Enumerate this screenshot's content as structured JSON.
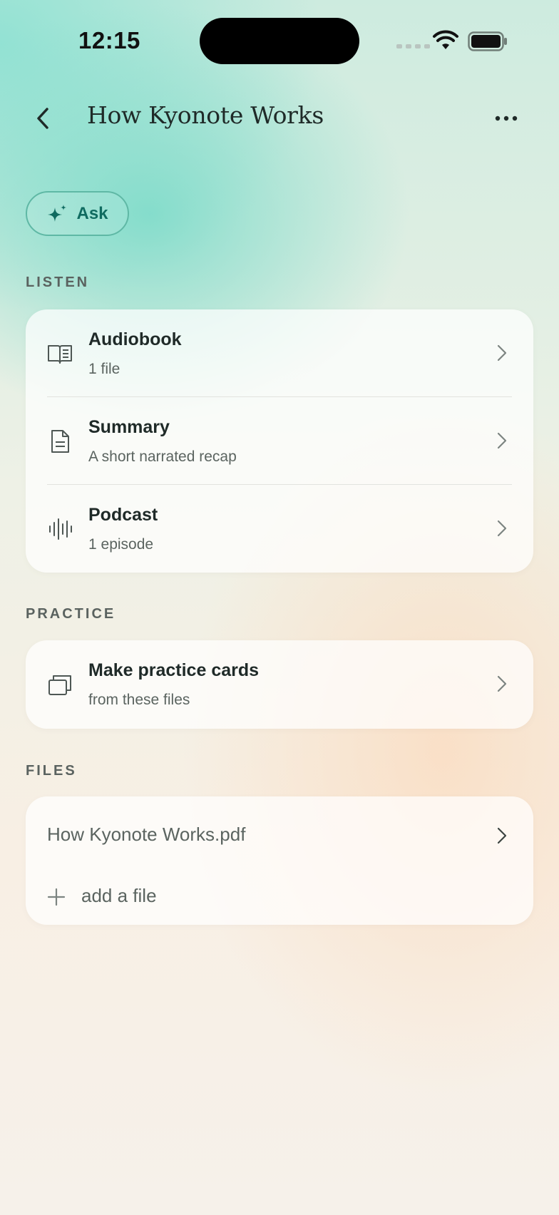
{
  "status_bar": {
    "time": "12:15"
  },
  "header": {
    "title": "How Kyonote Works"
  },
  "ask": {
    "label": "Ask"
  },
  "sections": {
    "listen": "LISTEN",
    "practice": "PRACTICE",
    "files": "FILES"
  },
  "listen_items": [
    {
      "title": "Audiobook",
      "subtitle": "1 file",
      "icon": "open-book-icon"
    },
    {
      "title": "Summary",
      "subtitle": "A short narrated recap",
      "icon": "document-icon"
    },
    {
      "title": "Podcast",
      "subtitle": "1 episode",
      "icon": "waveform-icon"
    }
  ],
  "practice_item": {
    "title": "Make practice cards",
    "subtitle": "from these files",
    "icon": "cards-icon"
  },
  "files": {
    "items": [
      "How Kyonote Works.pdf"
    ],
    "add_label": "add a file"
  },
  "colors": {
    "accent": "#0f6b60",
    "accent_border": "#5fb8a5"
  }
}
